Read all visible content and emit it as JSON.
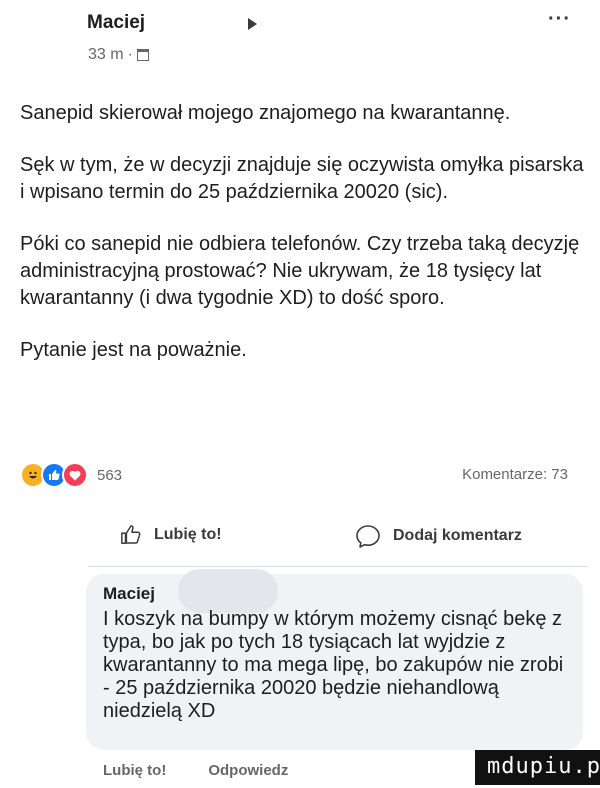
{
  "header": {
    "author": "Maciej",
    "time": "33 m",
    "separator": "·",
    "more": "···"
  },
  "post": {
    "paragraphs": [
      "Sanepid skierował mojego znajomego na kwarantannę.",
      "Sęk w tym, że w decyzji znajduje się oczywista omyłka pisarska i wpisano termin do 25 października 20020 (sic).",
      "Póki co sanepid nie odbiera telefonów. Czy trzeba taką decyzję administracyjną prostować? Nie ukrywam, że 18 tysięcy lat kwarantanny (i dwa tygodnie XD) to dość sporo.",
      "Pytanie jest na poważnie."
    ]
  },
  "stats": {
    "reactions_count": "563",
    "comments_count": "Komentarze: 73"
  },
  "actions": {
    "like": "Lubię to!",
    "comment": "Dodaj komentarz"
  },
  "comment": {
    "author": "Maciej",
    "text": "I koszyk na bumpy w którym możemy cisnąć bekę z typa, bo jak po tych 18 tysiącach lat wyjdzie z kwarantanny to ma mega lipę, bo zakupów nie zrobi - 25 października 20020 będzie niehandlową niedzielą XD",
    "like": "Lubię to!",
    "reply": "Odpowiedz"
  },
  "watermark": "mdupiu.pl",
  "colors": {
    "accent": "#1877f2",
    "love": "#f33e58",
    "haha": "#f7b125",
    "bubble": "#f0f2f5"
  }
}
